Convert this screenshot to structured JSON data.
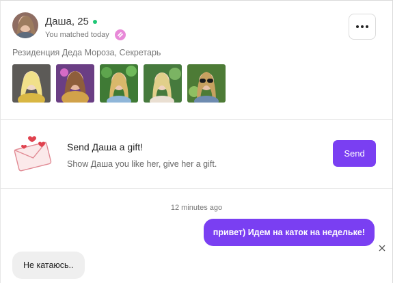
{
  "profile": {
    "name_age": "Даша, 25",
    "matched_text": "You matched today",
    "location": "Резиденция Деда Мороза, Секретарь",
    "photos": [
      "photo-1",
      "photo-2",
      "photo-3",
      "photo-4",
      "photo-5"
    ]
  },
  "gift": {
    "title": "Send Даша a gift!",
    "subtitle": "Show Даша you like her, give her a gift.",
    "send_label": "Send"
  },
  "chat": {
    "timestamp": "12 minutes ago",
    "messages": [
      {
        "direction": "out",
        "text": "привет) Идем на каток на недельке!"
      },
      {
        "direction": "in",
        "text": "Не катаюсь.."
      }
    ]
  },
  "colors": {
    "accent": "#7a3ff2",
    "online": "#1fc776",
    "match_badge": "#e889d8"
  },
  "icons": [
    "more-icon",
    "close-icon",
    "gift-envelope-icon",
    "online-status-icon",
    "match-badge-icon"
  ]
}
